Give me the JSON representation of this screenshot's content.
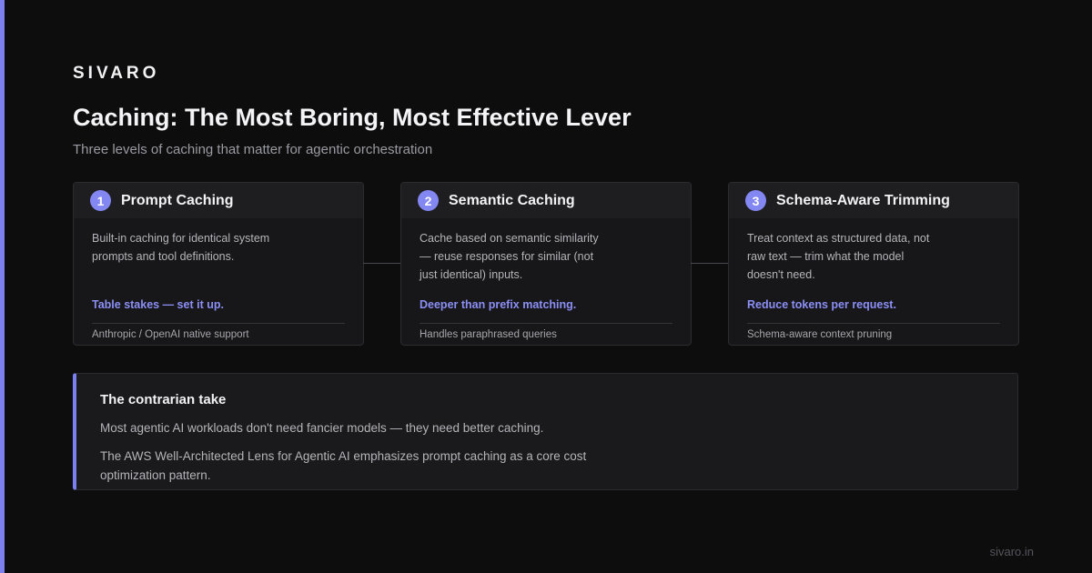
{
  "brand": "SIVARO",
  "title": "Caching: The Most Boring, Most Effective Lever",
  "subtitle": "Three levels of caching that matter for agentic orchestration",
  "cards": [
    {
      "number": "1",
      "title": "Prompt Caching",
      "description": "Built-in caching for identical system prompts and tool definitions.",
      "highlight": "Table stakes — set it up.",
      "footnote": "Anthropic / OpenAI native support"
    },
    {
      "number": "2",
      "title": "Semantic Caching",
      "description": "Cache based on semantic similarity — reuse responses for similar (not just identical) inputs.",
      "highlight": "Deeper than prefix matching.",
      "footnote": "Handles paraphrased queries"
    },
    {
      "number": "3",
      "title": "Schema-Aware Trimming",
      "description": "Treat context as structured data, not raw text — trim what the model doesn't need.",
      "highlight": "Reduce tokens per request.",
      "footnote": "Schema-aware context pruning"
    }
  ],
  "take": {
    "title": "The contrarian take",
    "paragraph1": "Most agentic AI workloads don't need fancier models — they need better caching.",
    "paragraph2": "The AWS Well-Architected Lens for Agentic AI emphasizes prompt caching as a core cost optimization pattern."
  },
  "footer_url": "sivaro.in",
  "colors": {
    "accent": "#7b7ff0",
    "background": "#0d0d0e",
    "card": "#171719",
    "highlight_text": "#8b8ff5"
  }
}
